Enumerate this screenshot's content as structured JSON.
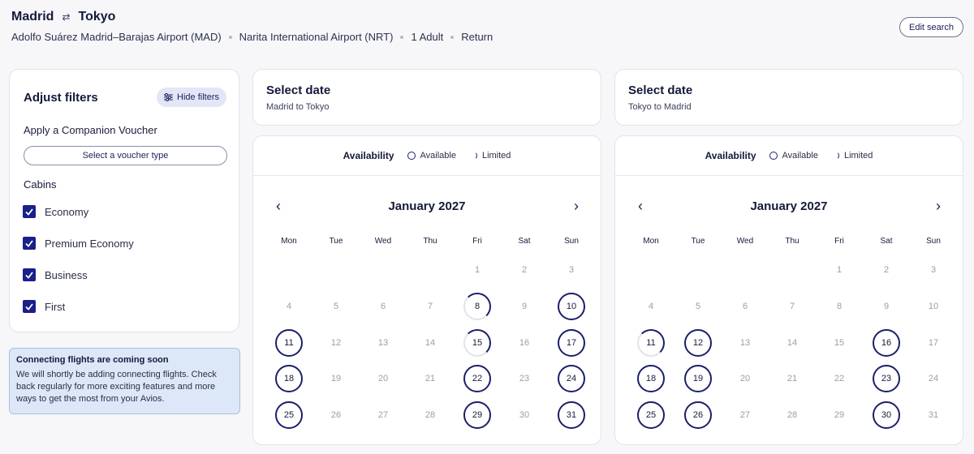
{
  "header": {
    "origin": "Madrid",
    "destination": "Tokyo",
    "origin_airport": "Adolfo Suárez Madrid–Barajas Airport (MAD)",
    "destination_airport": "Narita International Airport (NRT)",
    "passengers": "1 Adult",
    "trip_type": "Return",
    "edit_label": "Edit search"
  },
  "filters": {
    "title": "Adjust filters",
    "hide_label": "Hide filters",
    "voucher_title": "Apply a Companion Voucher",
    "voucher_placeholder": "Select a voucher type",
    "cabins_title": "Cabins",
    "cabins": [
      {
        "label": "Economy",
        "checked": true
      },
      {
        "label": "Premium Economy",
        "checked": true
      },
      {
        "label": "Business",
        "checked": true
      },
      {
        "label": "First",
        "checked": true
      }
    ]
  },
  "notice": {
    "title": "Connecting flights are coming soon",
    "body": "We will shortly be adding connecting flights. Check back regularly for more exciting features and more ways to get the most from your Avios."
  },
  "availability": {
    "title": "Availability",
    "available": "Available",
    "limited": "Limited"
  },
  "weekdays": [
    "Mon",
    "Tue",
    "Wed",
    "Thu",
    "Fri",
    "Sat",
    "Sun"
  ],
  "panels": [
    {
      "title": "Select date",
      "subtitle": "Madrid to Tokyo",
      "month": "January 2027",
      "available_days": [
        10,
        11,
        17,
        18,
        22,
        24,
        25,
        29,
        31
      ],
      "limited_days": [
        8,
        15
      ]
    },
    {
      "title": "Select date",
      "subtitle": "Tokyo to Madrid",
      "month": "January 2027",
      "available_days": [
        12,
        16,
        18,
        19,
        23,
        25,
        26,
        30
      ],
      "limited_days": [
        11
      ]
    }
  ],
  "colors": {
    "accent": "#1b1f6a",
    "notice_bg": "#dce8f7"
  }
}
